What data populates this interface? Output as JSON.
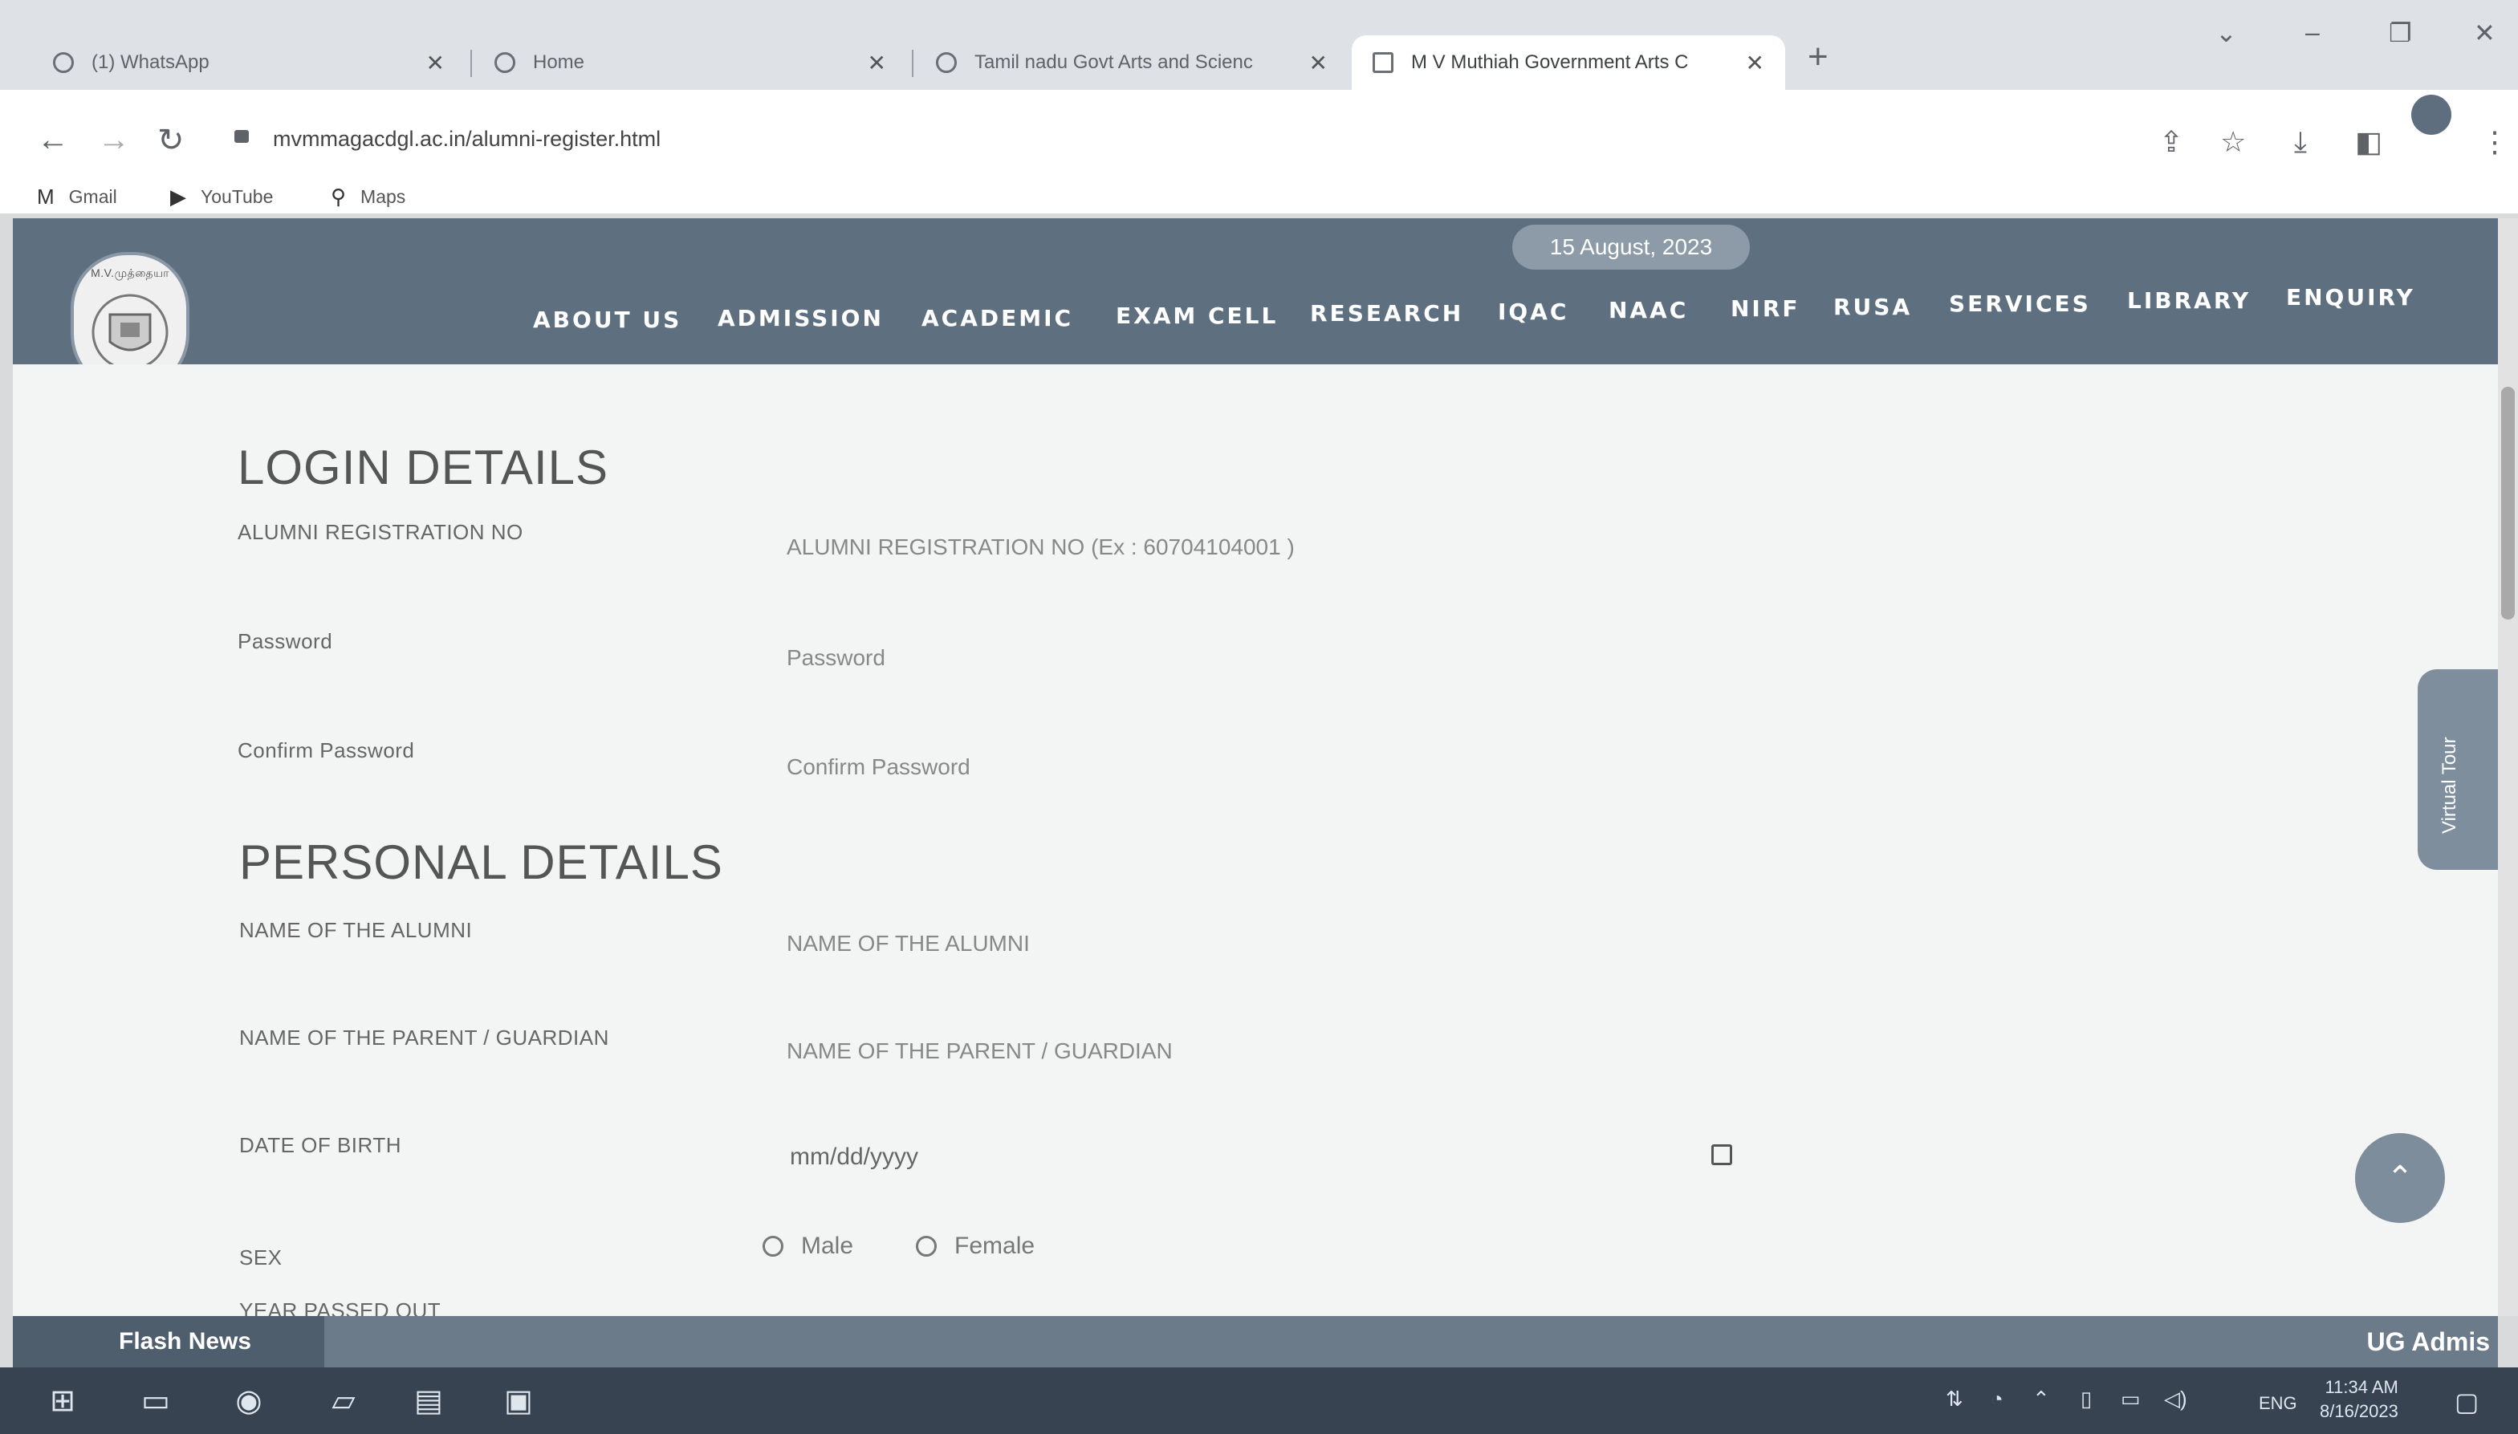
{
  "browser": {
    "tabs": [
      {
        "title": "(1) WhatsApp",
        "active": false
      },
      {
        "title": "Home",
        "active": false
      },
      {
        "title": "Tamil nadu Govt Arts and Scienc",
        "active": false
      },
      {
        "title": "M V Muthiah Government Arts C",
        "active": true
      }
    ],
    "new_tab": "+",
    "url": "mvmmagacdgl.ac.in/alumni-register.html",
    "bookmarks": [
      {
        "label": "Gmail",
        "icon": "gmail-icon",
        "glyph": "M"
      },
      {
        "label": "YouTube",
        "icon": "youtube-icon",
        "glyph": "▶"
      },
      {
        "label": "Maps",
        "icon": "maps-icon",
        "glyph": "⚲"
      }
    ]
  },
  "site": {
    "date": "15 August, 2023",
    "logo_text": "M.V.முத்தையா",
    "nav": [
      "ABOUT US",
      "ADMISSION",
      "ACADEMIC",
      "EXAM CELL",
      "RESEARCH",
      "IQAC",
      "NAAC",
      "NIRF",
      "RUSA",
      "SERVICES",
      "LIBRARY",
      "ENQUIRY"
    ],
    "virtual_tour": "Virtual Tour",
    "scroll_top": "⌃"
  },
  "form": {
    "login_title": "LOGIN DETAILS",
    "personal_title": "PERSONAL DETAILS",
    "fields": {
      "reg_no": {
        "label": "ALUMNI REGISTRATION NO",
        "placeholder": "ALUMNI REGISTRATION NO (Ex : 60704104001 )"
      },
      "password": {
        "label": "Password",
        "placeholder": "Password"
      },
      "confirm": {
        "label": "Confirm Password",
        "placeholder": "Confirm Password"
      },
      "alumni_name": {
        "label": "NAME OF THE ALUMNI",
        "placeholder": "NAME OF THE ALUMNI"
      },
      "parent_name": {
        "label": "NAME OF THE PARENT / GUARDIAN",
        "placeholder": "NAME OF THE PARENT / GUARDIAN"
      },
      "dob": {
        "label": "DATE OF BIRTH",
        "placeholder": "mm/dd/yyyy"
      },
      "sex": {
        "label": "SEX",
        "options": [
          "Male",
          "Female"
        ]
      },
      "year_passed": {
        "label": "YEAR PASSED OUT"
      }
    }
  },
  "flash": {
    "label": "Flash News",
    "right_text": "UG Admis"
  },
  "taskbar": {
    "lang": "ENG",
    "time": "11:34 AM",
    "date": "8/16/2023"
  }
}
